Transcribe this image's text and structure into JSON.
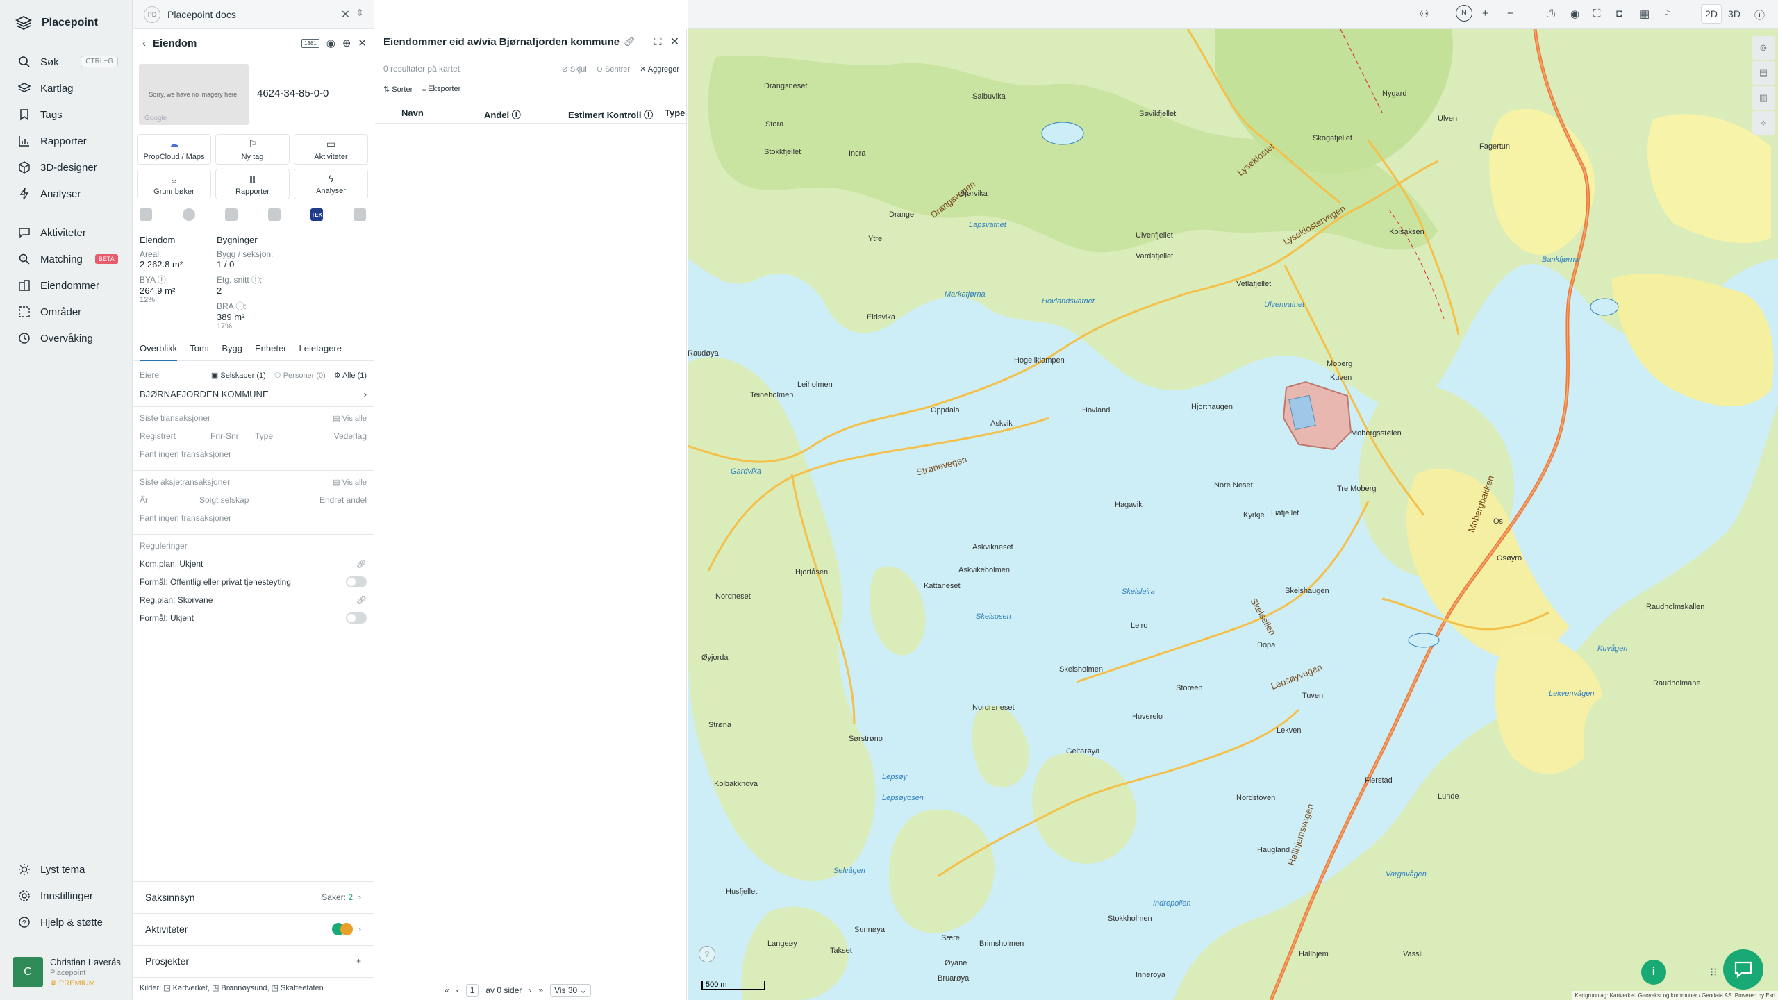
{
  "app": {
    "name": "Placepoint"
  },
  "nav": {
    "items": [
      {
        "label": "Søk",
        "shortcut": "CTRL+G"
      },
      {
        "label": "Kartlag"
      },
      {
        "label": "Tags"
      },
      {
        "label": "Rapporter"
      },
      {
        "label": "3D-designer"
      },
      {
        "label": "Analyser"
      },
      {
        "label": "Aktiviteter"
      },
      {
        "label": "Matching",
        "badge": "BETA"
      },
      {
        "label": "Eiendommer"
      },
      {
        "label": "Områder"
      },
      {
        "label": "Overvåking"
      }
    ],
    "bottom": [
      {
        "label": "Lyst tema"
      },
      {
        "label": "Innstillinger"
      },
      {
        "label": "Hjelp & støtte"
      }
    ],
    "user": {
      "initial": "C",
      "name": "Christian Løverås",
      "org": "Placepoint",
      "plan": "PREMIUM"
    }
  },
  "tab": {
    "badge": "PD",
    "title": "Placepoint docs"
  },
  "property": {
    "header": "Eiendom",
    "badge": "1881",
    "id": "4624-34-85-0-0",
    "no_imagery": "Sorry, we have no imagery here.",
    "google": "Google",
    "actions": [
      {
        "label": "PropCloud / Maps",
        "icon": "☁"
      },
      {
        "label": "Ny tag",
        "icon": "⚐"
      },
      {
        "label": "Aktiviteter",
        "icon": "▭"
      },
      {
        "label": "Grunnbøker",
        "icon": "⤓"
      },
      {
        "label": "Rapporter",
        "icon": "▥"
      },
      {
        "label": "Analyser",
        "icon": "ϟ"
      }
    ],
    "tek_label": "TEK",
    "stats": {
      "eiendom_heading": "Eiendom",
      "areal_label": "Areal:",
      "areal_value": "2 262.8 m²",
      "bya_label": "BYA ⓘ:",
      "bya_value": "264.9 m²",
      "bya_pct": "12%",
      "bygninger_heading": "Bygninger",
      "bygg_label": "Bygg / seksjon:",
      "bygg_value": "1 / 0",
      "etg_label": "Etg. snitt ⓘ:",
      "etg_value": "2",
      "bra_label": "BRA ⓘ:",
      "bra_value": "389 m²",
      "bra_pct": "17%"
    },
    "tabs": [
      "Overblikk",
      "Tomt",
      "Bygg",
      "Enheter",
      "Leietagere"
    ],
    "owners": {
      "label": "Eiere",
      "filters": [
        "Selskaper (1)",
        "Personer (0)",
        "Alle (1)"
      ],
      "name": "BJØRNAFJORDEN KOMMUNE"
    },
    "transactions": {
      "title": "Siste transaksjoner",
      "show_all": "Vis alle",
      "cols": [
        "Registrert",
        "Fnr-Snr",
        "Type",
        "Vederlag"
      ],
      "empty": "Fant ingen transaksjoner"
    },
    "share_transactions": {
      "title": "Siste aksjetransaksjoner",
      "show_all": "Vis alle",
      "cols": [
        "År",
        "Solgt selskap",
        "Endret andel"
      ],
      "empty": "Fant ingen transaksjoner"
    },
    "regulations": {
      "title": "Reguleringer",
      "rows": [
        "Kom.plan: Ukjent",
        "Formål: Offentlig eller privat tjenesteyting",
        "Reg.plan: Skorvane",
        "Formål: Ukjent"
      ]
    },
    "accordions": {
      "saksinnsyn": "Saksinnsyn",
      "saker_label": "Saker:",
      "saker_count": "2",
      "aktiviteter": "Aktiviteter",
      "prosjekter": "Prosjekter"
    },
    "sources": {
      "label": "Kilder:",
      "items": [
        "Kartverket",
        "Brønnøysund",
        "Skatteetaten"
      ]
    }
  },
  "results": {
    "title": "Eiendommer eid av/via Bjørnafjorden kommune",
    "count": "0 resultater på kartet",
    "actions": [
      "Skjul",
      "Sentrer",
      "Aggreger"
    ],
    "tools": [
      "Sorter",
      "Eksporter"
    ],
    "columns": [
      "Navn",
      "Andel ⓘ",
      "Estimert Kontroll ⓘ",
      "Type"
    ],
    "pager": {
      "page": "1",
      "of": "av 0 sider",
      "per_page": "Vis 30"
    }
  },
  "topbar": {
    "compass": "N",
    "mode_2d": "2D",
    "mode_3d": "3D"
  },
  "map": {
    "scale": "500 m",
    "attribution": "Kartgrunnlag: Kartverket, Geovekst og kommuner / Geodata AS. Powered by Esri",
    "place_labels": [
      "Drangsneset",
      "Stora",
      "Stokkfjellet",
      "Incra",
      "Drange",
      "Ytre",
      "Salbuvika",
      "Søvikfjellet",
      "Drangsvegen",
      "Bjørvika",
      "Lapsvatnet",
      "Markatjørna",
      "Eidsvika",
      "Hovlandsvatnet",
      "Hogeliklampen",
      "Oppdala",
      "Hovland",
      "Askvik",
      "Strønevegen",
      "Hjorthaugen",
      "Ulvenfjellet",
      "Vardafjellet",
      "Vetlafjellet",
      "Lysekloster",
      "Skogafjellet",
      "Nygard",
      "Ulven",
      "Fagertun",
      "Bankfjørna",
      "Koisaksen",
      "Ulvenvatnet",
      "Moberg",
      "Kuven",
      "Mobergsstølen",
      "Lyseklostervegen",
      "Liafjellet",
      "Tre Moberg",
      "Os",
      "Osøyro",
      "Raudholmskallen",
      "Hagavik",
      "Nore Neset",
      "Kyrkje",
      "Skeishaugen",
      "Askvikneset",
      "Askvikeholmen",
      "Skeisleira",
      "Skeisosen",
      "Skeiselien",
      "Leiro",
      "Skeisholmen",
      "Dopa",
      "Lepsøyvegen",
      "Storeen",
      "Hoverelo",
      "Tuven",
      "Lekven",
      "Raudholmane",
      "Kuvågen",
      "Lekvenvågen",
      "Hjortåsen",
      "Nordneset",
      "Øyjorda",
      "Strøna",
      "Sørstrøno",
      "Kolbakknova",
      "Gardvika",
      "Teineholmen",
      "Leiholmen",
      "Raudøya",
      "Kattaneset",
      "Nordreneset",
      "Geitarøya",
      "Lepsøy",
      "Lepsøyosen",
      "Selvågen",
      "Husfjellet",
      "Langeøy",
      "Sunnøya",
      "Takset",
      "Sære",
      "Brimsholmen",
      "Øyane",
      "Bruarøya",
      "Stokkholmen",
      "Inneroya",
      "Indrepollen",
      "Haugland",
      "Flerstad",
      "Lunde",
      "Hallhjemsvegen",
      "Hallhjem",
      "Vassli",
      "Vargavågen",
      "Nordstoven",
      "Mobergbakken"
    ]
  }
}
